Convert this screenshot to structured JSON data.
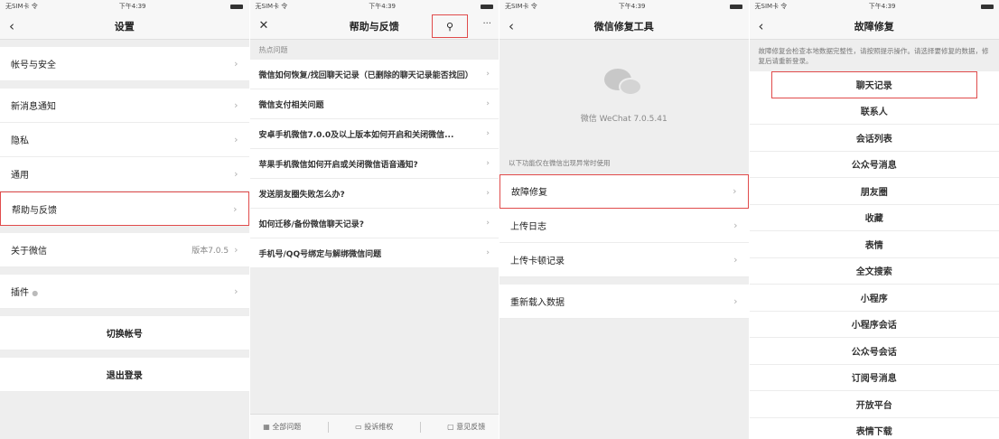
{
  "status": {
    "carrier": "无SIM卡 令",
    "time": "下午4:39"
  },
  "screen1": {
    "title": "设置",
    "rows_a": [
      {
        "label": "帐号与安全"
      }
    ],
    "rows_b": [
      {
        "label": "新消息通知"
      },
      {
        "label": "隐私"
      },
      {
        "label": "通用"
      },
      {
        "label": "帮助与反馈"
      }
    ],
    "about": {
      "label": "关于微信",
      "value": "版本7.0.5"
    },
    "plugins": {
      "label": "插件"
    },
    "switch_account": "切换帐号",
    "logout": "退出登录"
  },
  "screen2": {
    "title": "帮助与反馈",
    "pin_icon": "wrench-icon",
    "more": "···",
    "section": "热点问题",
    "questions": [
      "微信如何恢复/找回聊天记录（已删除的聊天记录能否找回）",
      "微信支付相关问题",
      "安卓手机微信7.0.0及以上版本如何开启和关闭微信...",
      "苹果手机微信如何开启或关闭微信语音通知?",
      "发送朋友圈失败怎么办?",
      "如何迁移/备份微信聊天记录?",
      "手机号/QQ号绑定与解绑微信问题"
    ],
    "tabs": [
      "全部问题",
      "投诉维权",
      "意见反馈"
    ]
  },
  "screen3": {
    "title": "微信修复工具",
    "version": "微信 WeChat 7.0.5.41",
    "note": "以下功能仅在微信出现异常时使用",
    "rows_a": [
      {
        "label": "故障修复"
      },
      {
        "label": "上传日志"
      },
      {
        "label": "上传卡顿记录"
      }
    ],
    "rows_b": [
      {
        "label": "重新载入数据"
      }
    ]
  },
  "screen4": {
    "title": "故障修复",
    "note": "故障修复会检查本地数据完整性，请按照提示操作。请选择要修复的数据，修复后请重新登录。",
    "items": [
      "聊天记录",
      "联系人",
      "会话列表",
      "公众号消息",
      "朋友圈",
      "收藏",
      "表情",
      "全文搜索",
      "小程序",
      "小程序会话",
      "公众号会话",
      "订阅号消息",
      "开放平台",
      "表情下载"
    ]
  }
}
